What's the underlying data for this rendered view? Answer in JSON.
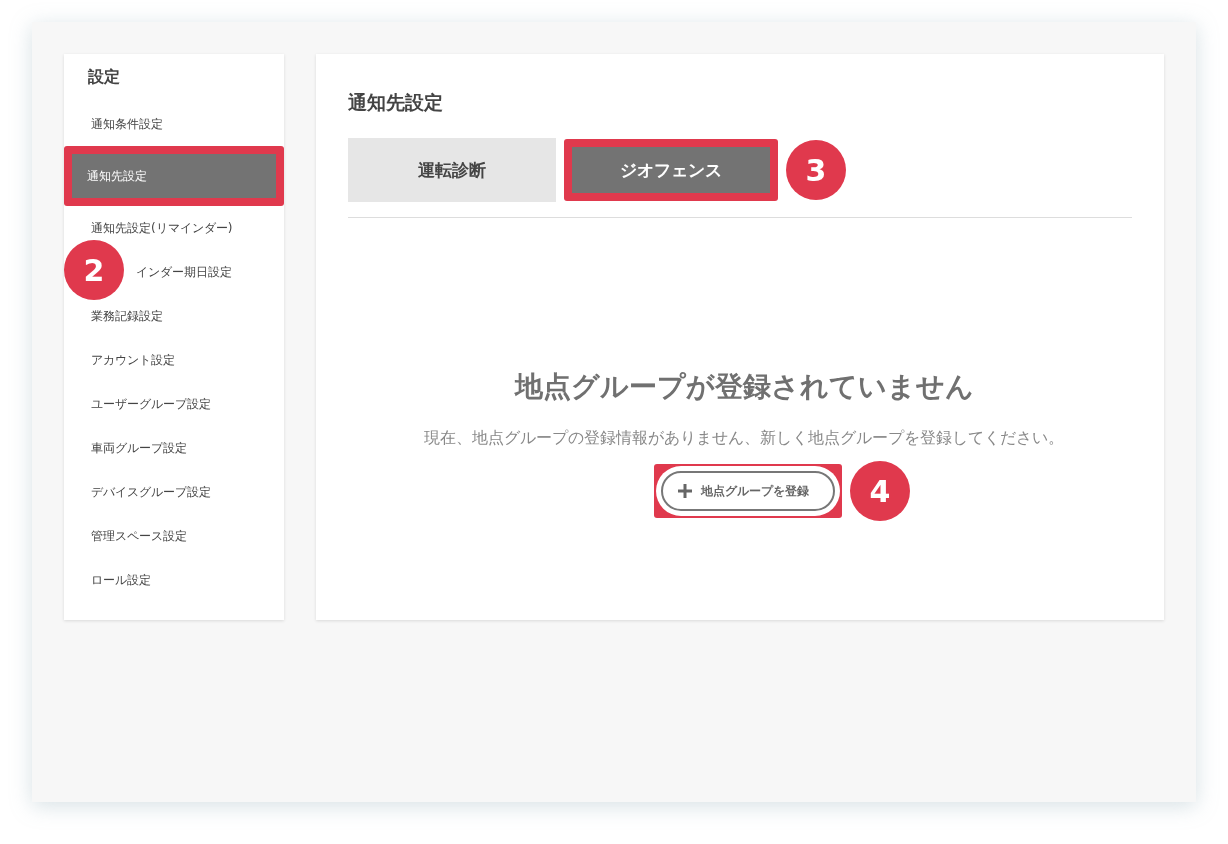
{
  "sidebar": {
    "title": "設定",
    "callout": "2",
    "items": [
      {
        "label": "通知条件設定",
        "selected": false,
        "highlighted": false,
        "kind": "plain"
      },
      {
        "label": "通知先設定",
        "selected": true,
        "highlighted": true,
        "kind": "plain"
      },
      {
        "label": "通知先設定(リマインダー)",
        "selected": false,
        "highlighted": false,
        "kind": "plain"
      },
      {
        "label": "インダー期日設定",
        "selected": false,
        "highlighted": false,
        "kind": "covered"
      },
      {
        "label": "業務記録設定",
        "selected": false,
        "highlighted": false,
        "kind": "plain"
      },
      {
        "label": "アカウント設定",
        "selected": false,
        "highlighted": false,
        "kind": "plain"
      },
      {
        "label": "ユーザーグループ設定",
        "selected": false,
        "highlighted": false,
        "kind": "plain"
      },
      {
        "label": "車両グループ設定",
        "selected": false,
        "highlighted": false,
        "kind": "plain"
      },
      {
        "label": "デバイスグループ設定",
        "selected": false,
        "highlighted": false,
        "kind": "plain"
      },
      {
        "label": "管理スペース設定",
        "selected": false,
        "highlighted": false,
        "kind": "plain"
      },
      {
        "label": "ロール設定",
        "selected": false,
        "highlighted": false,
        "kind": "plain"
      }
    ]
  },
  "main": {
    "title": "通知先設定",
    "tabs": [
      {
        "label": "運転診断",
        "selected": false,
        "highlighted": false
      },
      {
        "label": "ジオフェンス",
        "selected": true,
        "highlighted": true,
        "callout": "3"
      }
    ],
    "empty_state": {
      "heading": "地点グループが登録されていません",
      "message": "現在、地点グループの登録情報がありません、新しく地点グループを登録してください。",
      "button": {
        "label": "地点グループを登録",
        "highlighted": true,
        "callout": "4"
      }
    }
  }
}
